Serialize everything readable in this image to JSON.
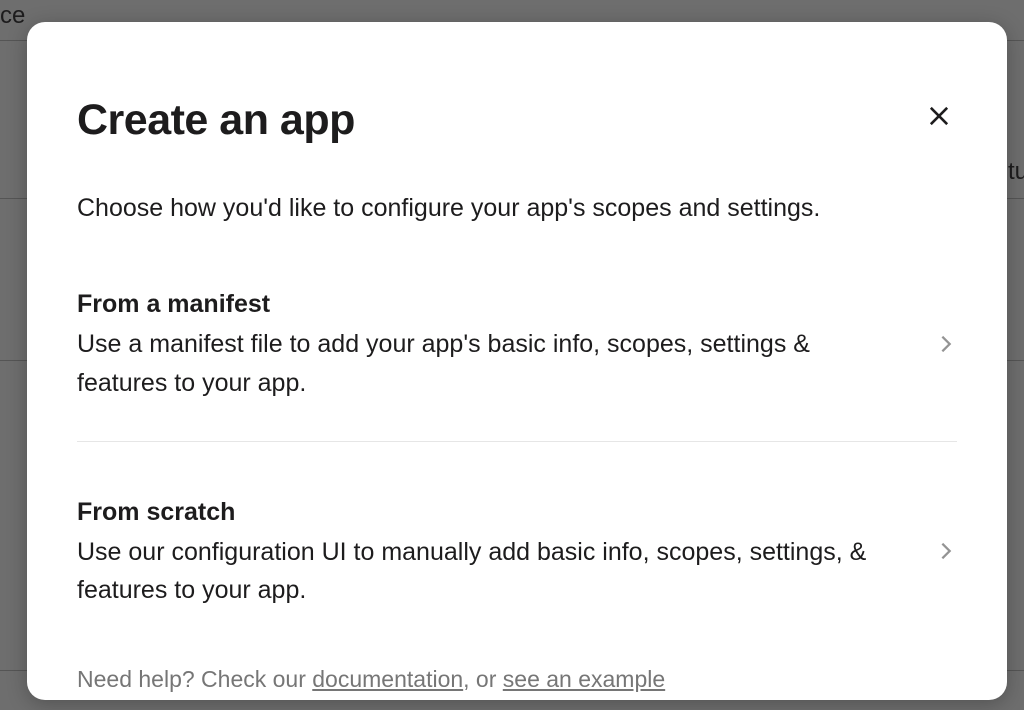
{
  "dialog": {
    "title": "Create an app",
    "subtitle": "Choose how you'd like to configure your app's scopes and settings.",
    "options": [
      {
        "title": "From a manifest",
        "description": "Use a manifest file to add your app's basic info, scopes, settings & features to your app."
      },
      {
        "title": "From scratch",
        "description": "Use our configuration UI to manually add basic info, scopes, settings, & features to your app."
      }
    ],
    "help": {
      "prefix": "Need help? Check our ",
      "link1": "documentation",
      "middle": ", or ",
      "link2": "see an example"
    }
  },
  "background": {
    "fragment1": "ce",
    "fragment2": "tu"
  }
}
